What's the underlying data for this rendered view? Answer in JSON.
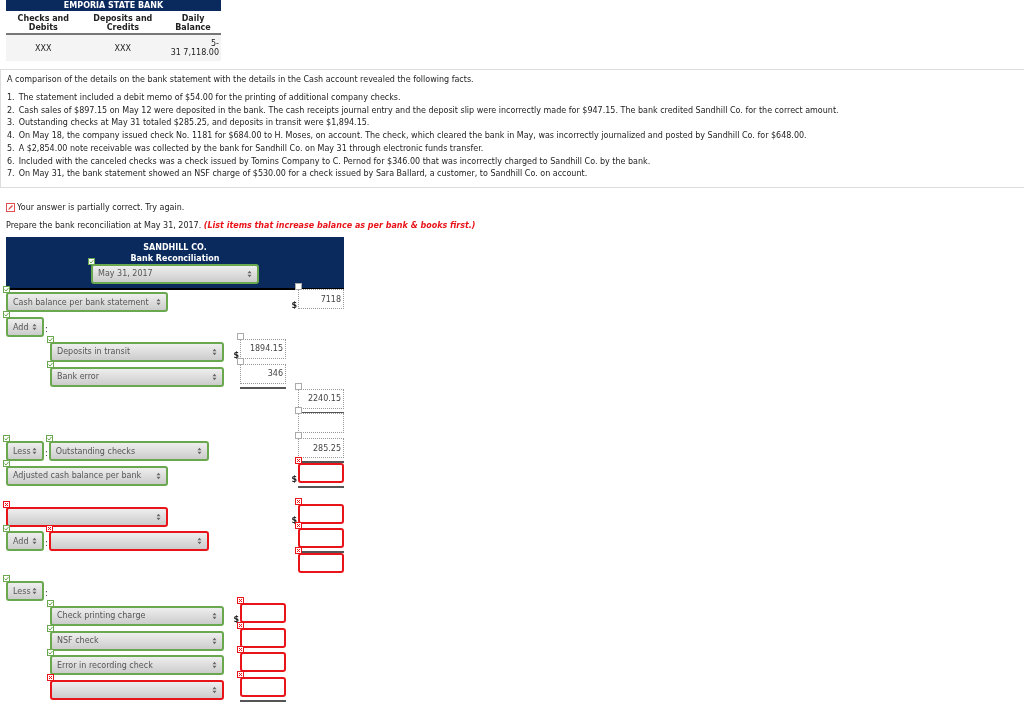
{
  "bank_table": {
    "title": "EMPORIA STATE BANK",
    "columns": [
      "Checks and Debits",
      "Deposits and Credits",
      "Daily Balance"
    ],
    "rows": [
      [
        [
          "XXX"
        ],
        [
          "XXX"
        ],
        [
          "5-",
          "31 7,118.00"
        ]
      ]
    ]
  },
  "facts": {
    "intro": "A comparison of the details on the bank statement with the details in the Cash account revealed the following facts.",
    "items": [
      {
        "number": "1.",
        "text": "The statement included a debit memo of $54.00 for the printing of additional company checks."
      },
      {
        "number": "2.",
        "text": "Cash sales of $897.15 on May 12 were deposited in the bank. The cash receipts journal entry and the deposit slip were incorrectly made for $947.15. The bank credited Sandhill Co. for the correct amount."
      },
      {
        "number": "3.",
        "text": "Outstanding checks at May 31 totaled $285.25, and deposits in transit were $1,894.15."
      },
      {
        "number": "4.",
        "text": "On May 18, the company issued check No. 1181 for $684.00 to H. Moses, on account. The check, which cleared the bank in May, was incorrectly journalized and posted by Sandhill Co. for $648.00."
      },
      {
        "number": "5.",
        "text": "A $2,854.00 note receivable was collected by the bank for Sandhill Co. on May 31 through electronic funds transfer."
      },
      {
        "number": "6.",
        "text": "Included with the canceled checks was a check issued by Tomins Company to C. Pernod for $346.00 that was incorrectly charged to Sandhill Co. by the bank."
      },
      {
        "number": "7.",
        "text": "On May 31, the bank statement showed an NSF charge of $530.00 for a check issued by Sara Ballard, a customer, to Sandhill Co. on account."
      }
    ]
  },
  "feedback": {
    "partial": true,
    "text": "Your answer is partially correct.  Try again."
  },
  "instruction": {
    "text": "Prepare the bank reconciliation at May 31, 2017.",
    "emphasis": "(List items that increase balance as per bank & books first.)"
  },
  "reconciliation": {
    "company": "SANDHILL CO.",
    "title": "Bank Reconciliation",
    "date": {
      "value": "May 31, 2017",
      "graded": true,
      "correct": true
    },
    "rows": [
      {
        "kind": "main",
        "select": {
          "value": "Cash balance per bank statement",
          "graded": true,
          "correct": true
        },
        "right": {
          "value": "7118",
          "graded": false,
          "currency": "$",
          "underline": false
        }
      },
      {
        "kind": "prefixed",
        "prefix": {
          "value": "Add",
          "graded": true,
          "correct": true
        },
        "separator": ":"
      },
      {
        "kind": "sub",
        "select": {
          "value": "Deposits in transit",
          "graded": true,
          "correct": true
        },
        "middle": {
          "value": "1894.15",
          "graded": false,
          "currency": "$",
          "underline": false
        }
      },
      {
        "kind": "sub",
        "select": {
          "value": "Bank error",
          "graded": true,
          "correct": true
        },
        "middle": {
          "value": "346",
          "graded": false,
          "underline": true
        }
      },
      {
        "kind": "amount",
        "right": {
          "value": "2240.15",
          "graded": false,
          "underline": true
        }
      },
      {
        "kind": "amount",
        "right": {
          "graded": false,
          "underline": false
        }
      },
      {
        "kind": "prefixed",
        "prefix": {
          "value": "Less",
          "graded": true,
          "correct": true
        },
        "separator": ":",
        "select": {
          "value": "Outstanding checks",
          "graded": true,
          "correct": true
        },
        "right": {
          "value": "285.25",
          "graded": false,
          "underline": true
        }
      },
      {
        "kind": "main",
        "select": {
          "value": "Adjusted cash balance per bank",
          "graded": true,
          "correct": true
        },
        "right": {
          "graded": true,
          "correct": false,
          "currency": "$",
          "underline": true
        }
      },
      {
        "kind": "gap"
      },
      {
        "kind": "main",
        "select": {
          "graded": true,
          "correct": false
        },
        "right": {
          "graded": true,
          "correct": false,
          "currency": "$",
          "underline": false
        }
      },
      {
        "kind": "prefixed",
        "prefix": {
          "value": "Add",
          "graded": true,
          "correct": true
        },
        "separator": ":",
        "select": {
          "graded": true,
          "correct": false
        },
        "right": {
          "graded": true,
          "correct": false,
          "underline": true
        }
      },
      {
        "kind": "amount",
        "right": {
          "graded": true,
          "correct": false,
          "underline": false
        }
      },
      {
        "kind": "prefixed",
        "prefix": {
          "value": "Less",
          "graded": true,
          "correct": true
        },
        "separator": ":"
      },
      {
        "kind": "sub",
        "select": {
          "value": "Check printing charge",
          "graded": true,
          "correct": true
        },
        "middle": {
          "graded": true,
          "correct": false,
          "currency": "$",
          "underline": false
        }
      },
      {
        "kind": "sub",
        "select": {
          "value": "NSF check",
          "graded": true,
          "correct": true
        },
        "middle": {
          "graded": true,
          "correct": false,
          "underline": false
        }
      },
      {
        "kind": "sub",
        "select": {
          "value": "Error in recording check",
          "graded": true,
          "correct": true
        },
        "middle": {
          "graded": true,
          "correct": false,
          "underline": false
        }
      },
      {
        "kind": "sub",
        "select": {
          "graded": true,
          "correct": false
        },
        "middle": {
          "graded": true,
          "correct": false,
          "underline": true
        }
      }
    ]
  }
}
